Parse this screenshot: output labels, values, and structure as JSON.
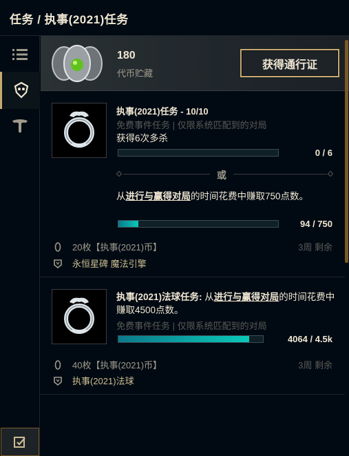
{
  "header": {
    "title": "任务 / 执事(2021)任务"
  },
  "sidebar": {
    "icons": [
      "list-icon",
      "mission-badge-icon",
      "t-logo-icon",
      "checkbox-icon"
    ]
  },
  "currency": {
    "amount": "180",
    "label": "代币贮藏",
    "button": "获得通行证"
  },
  "missions": [
    {
      "title": "执事(2021)任务 - 10/10",
      "subtitle": "免费事件任务 | 仅限系统匹配到的对局",
      "objective1": "获得6次多杀",
      "progress1": {
        "value": 0,
        "max": 6,
        "label": "0 / 6"
      },
      "or": "或",
      "objective2_pre": "从",
      "objective2_link": "进行与赢得对局",
      "objective2_post": "的时间花费中赚取750点数。",
      "progress2": {
        "value": 94,
        "max": 750,
        "label": "94 / 750"
      },
      "rewards": [
        "20枚【执事(2021)币】",
        "永恒星碑 魔法引擎"
      ],
      "time_left": "3周 剩余"
    },
    {
      "title": "执事(2021)法球任务:",
      "text_pre": " 从",
      "text_link": "进行与赢得对局",
      "text_post": "的时间花费中赚取4500点数。",
      "subtitle": "免费事件任务 | 仅限系统匹配到的对局",
      "progress": {
        "value": 4064,
        "max": 4500,
        "label": "4064 / 4.5k"
      },
      "rewards": [
        "40枚【执事(2021)币】",
        "执事(2021)法球"
      ],
      "time_left": "3周 剩余"
    }
  ],
  "colors": {
    "gold": "#c8aa6e",
    "teal": "#0ac8b9",
    "bg": "#010a13"
  }
}
